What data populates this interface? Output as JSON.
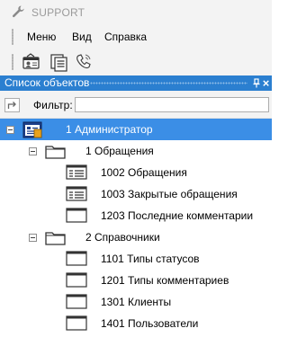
{
  "app": {
    "title": "SUPPORT"
  },
  "menu": {
    "items": [
      {
        "label": "Меню"
      },
      {
        "label": "Вид"
      },
      {
        "label": "Справка"
      }
    ]
  },
  "toolbar": {
    "buttons": [
      {
        "icon": "person-card-icon"
      },
      {
        "icon": "documents-icon"
      },
      {
        "icon": "phone-icon"
      }
    ]
  },
  "panel": {
    "title": "Список объектов",
    "pin_glyph": "↑",
    "close_glyph": "×"
  },
  "filter": {
    "label": "Фильтр:",
    "value": "",
    "placeholder": ""
  },
  "colors": {
    "accent": "#2b7fd0",
    "selection": "#3b8ee6",
    "chrome": "#f3f3f3"
  },
  "tree": {
    "root": {
      "label": "1 Администратор",
      "selected": true,
      "expanded": true
    },
    "groups": [
      {
        "label": "1 Обращения",
        "expanded": true,
        "items": [
          {
            "label": "1002 Обращения"
          },
          {
            "label": "1003 Закрытые обращения"
          },
          {
            "label": "1203 Последние комментарии"
          }
        ]
      },
      {
        "label": "2 Справочники",
        "expanded": true,
        "items": [
          {
            "label": "1101 Типы статусов"
          },
          {
            "label": "1201 Типы комментариев"
          },
          {
            "label": "1301 Клиенты"
          },
          {
            "label": "1401 Пользователи"
          }
        ]
      }
    ]
  }
}
